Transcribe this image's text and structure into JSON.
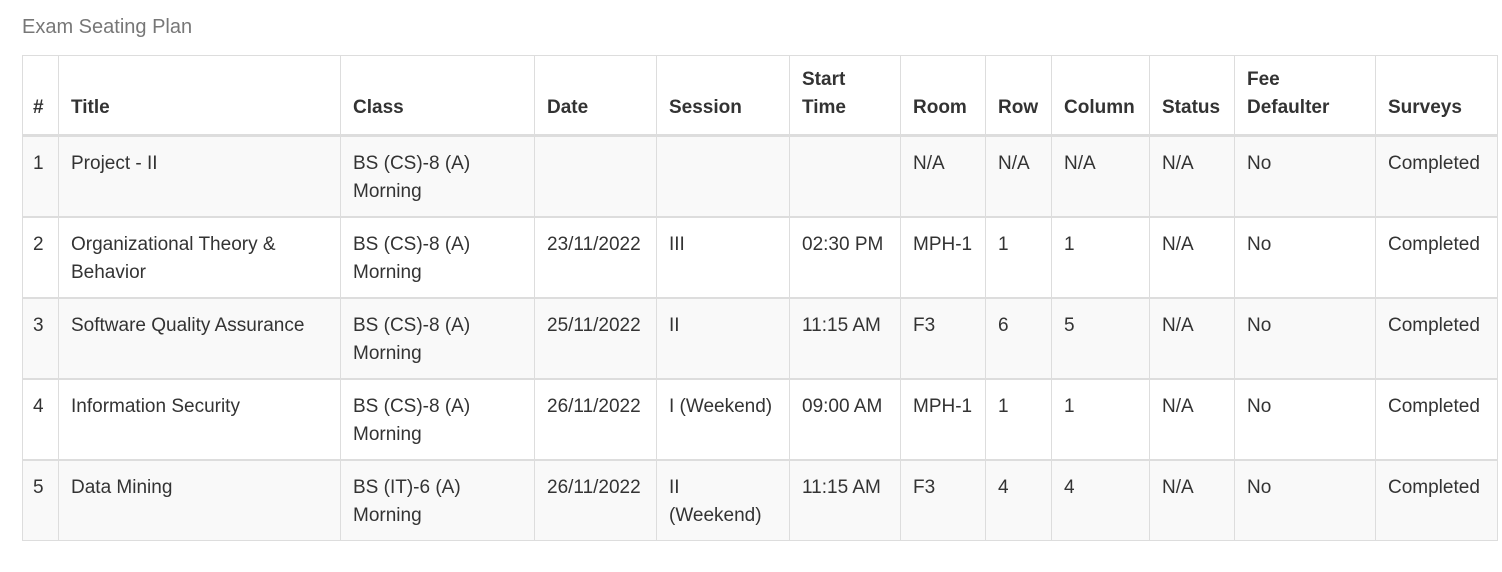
{
  "page": {
    "title": "Exam Seating Plan"
  },
  "table": {
    "columns": [
      "#",
      "Title",
      "Class",
      "Date",
      "Session",
      "Start Time",
      "Room",
      "Row",
      "Column",
      "Status",
      "Fee Defaulter",
      "Surveys"
    ],
    "rows": [
      {
        "num": "1",
        "title": "Project - II",
        "class": "BS (CS)-8 (A) Morning",
        "date": "",
        "session": "",
        "start_time": "",
        "room": "N/A",
        "row": "N/A",
        "column": "N/A",
        "status": "N/A",
        "fee_defaulter": "No",
        "surveys": "Completed"
      },
      {
        "num": "2",
        "title": "Organizational Theory & Behavior",
        "class": "BS (CS)-8 (A) Morning",
        "date": "23/11/2022",
        "session": "III",
        "start_time": "02:30 PM",
        "room": "MPH-1",
        "row": "1",
        "column": "1",
        "status": "N/A",
        "fee_defaulter": "No",
        "surveys": "Completed"
      },
      {
        "num": "3",
        "title": "Software Quality Assurance",
        "class": "BS (CS)-8 (A) Morning",
        "date": "25/11/2022",
        "session": "II",
        "start_time": "11:15 AM",
        "room": "F3",
        "row": "6",
        "column": "5",
        "status": "N/A",
        "fee_defaulter": "No",
        "surveys": "Completed"
      },
      {
        "num": "4",
        "title": "Information Security",
        "class": "BS (CS)-8 (A) Morning",
        "date": "26/11/2022",
        "session": "I (Weekend)",
        "start_time": "09:00 AM",
        "room": "MPH-1",
        "row": "1",
        "column": "1",
        "status": "N/A",
        "fee_defaulter": "No",
        "surveys": "Completed"
      },
      {
        "num": "5",
        "title": "Data Mining",
        "class": "BS (IT)-6 (A) Morning",
        "date": "26/11/2022",
        "session": "II (Weekend)",
        "start_time": "11:15 AM",
        "room": "F3",
        "row": "4",
        "column": "4",
        "status": "N/A",
        "fee_defaulter": "No",
        "surveys": "Completed"
      }
    ]
  }
}
